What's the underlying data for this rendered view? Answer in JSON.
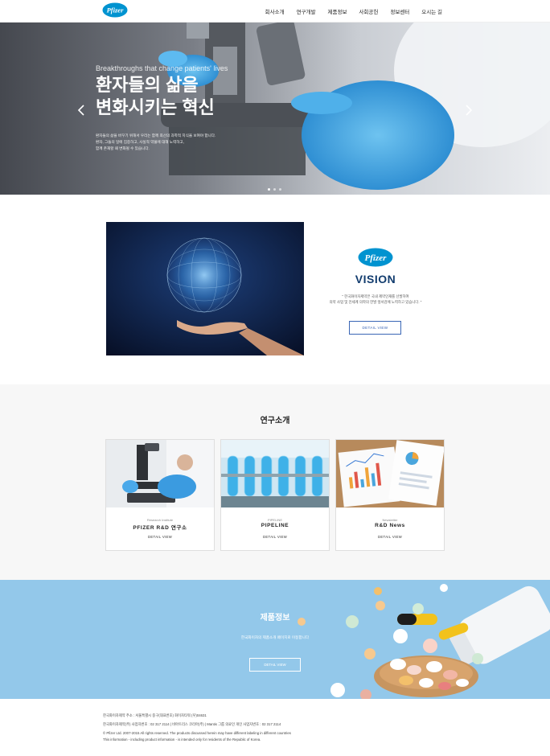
{
  "header": {
    "logo_text": "Pfizer",
    "nav": [
      "회사소개",
      "연구개발",
      "제품정보",
      "사회공헌",
      "정보센터",
      "오시는 길"
    ]
  },
  "hero": {
    "subtitle": "Breakthroughs that change patients' lives",
    "title_line1": "환자들의 삶을",
    "title_line2": "변화시키는 혁신",
    "desc_line1": "환자들의 삶을 바꾸기 위해서 우리는 함께 최선의 과학적 지식을 보여야 합니다.",
    "desc_line2": "환자, 그들의 일에 집중하고, 사실적 약물에 대해 노력하고,",
    "desc_line3": "함께 존재할 때 변화될 수 있습니다."
  },
  "vision": {
    "logo_text": "Pfizer",
    "title": "VISION",
    "desc_line1": "\" 한국화이자제약은 국내 제약인재를 선발하여",
    "desc_line2": "의약 사업 및 전세계 의학의 한발 앞서감에 노력하고 있습니다. \"",
    "button": "DETAIL VIEW"
  },
  "research": {
    "title": "연구소개",
    "cards": [
      {
        "eyebrow": "Research Institute",
        "title": "PFIZER R&D 연구소",
        "link": "DETAIL VIEW"
      },
      {
        "eyebrow": "PIPELINE",
        "title": "PIPELINE",
        "link": "DETAIL VIEW"
      },
      {
        "eyebrow": "Newsletter",
        "title": "R&D News",
        "link": "DETAIL VIEW"
      }
    ]
  },
  "products": {
    "title": "제품정보",
    "desc": "한국화이자의 제품소개 페이지로 이동합니다",
    "button": "DETAIL VIEW"
  },
  "footer": {
    "line1": "한국화이자제약 주소 : 서울특별시 중구(대표번호) 화이자타워 (우)04631",
    "line2": "한국화이자제약(주) 사업자번호 : 02 317 2114 | 비아트리스 코리아(주) | Mantis 그룹 의료인 개인 사업자번호 : 02 317 2114",
    "line3": "© Pfizer Ltd. 2007-2015 All rights reserved. The products discussed herein may have different labeling in different countries",
    "line4": "This information - including product information - is intended only for residents of the Republic of Korea."
  },
  "colors": {
    "brand_blue": "#0093d0",
    "vision_navy": "#123c6e",
    "button_blue": "#3a66b5",
    "products_bg": "#8fc4e8"
  }
}
